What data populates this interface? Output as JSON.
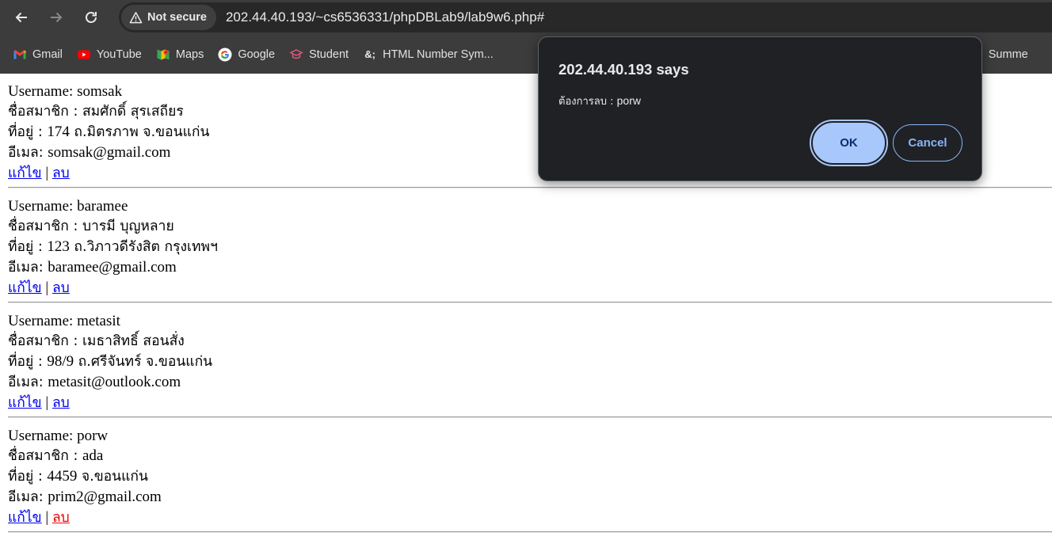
{
  "browser": {
    "security_label": "Not secure",
    "url": "202.44.40.193/~cs6536331/phpDBLab9/lab9w6.php#"
  },
  "bookmarks": [
    {
      "label": "Gmail",
      "icon": "gmail-icon"
    },
    {
      "label": "YouTube",
      "icon": "youtube-icon"
    },
    {
      "label": "Maps",
      "icon": "maps-icon"
    },
    {
      "label": "Google",
      "icon": "google-icon"
    },
    {
      "label": "Student",
      "icon": "student-icon"
    },
    {
      "label": "HTML Number Sym...",
      "icon": "ampersand-icon"
    },
    {
      "label": "Summe",
      "icon": "summer-icon"
    }
  ],
  "labels": {
    "username": "Username: ",
    "name": "ชื่อสมาชิก : ",
    "address": "ที่อยู่ : ",
    "email": "อีเมล: ",
    "edit": "แก้ไข",
    "separator": " | ",
    "delete": "ลบ"
  },
  "records": [
    {
      "username": "somsak",
      "name": "สมศักดิ์ สุรเสถียร",
      "address_num": "174",
      "address_text": " ถ.มิตรภาพ จ.ขอนแก่น",
      "email": "somsak@gmail.com"
    },
    {
      "username": "baramee",
      "name": "บารมี บุญหลาย",
      "address_num": "123",
      "address_text": " ถ.วิภาวดีรังสิต กรุงเทพฯ",
      "email": "baramee@gmail.com"
    },
    {
      "username": "metasit",
      "name": "เมธาสิทธิ์ สอนสั่ง",
      "address_num": "98/9",
      "address_text": " ถ.ศรีจันทร์ จ.ขอนแก่น",
      "email": "metasit@outlook.com"
    },
    {
      "username": "porw",
      "name": "ada",
      "address_num": "4459",
      "address_text": " จ.ขอนแก่น",
      "email": "prim2@gmail.com"
    }
  ],
  "dialog": {
    "title": "202.44.40.193 says",
    "message_prefix": "ต้องการลบ : ",
    "message_value": "porw",
    "ok_label": "OK",
    "cancel_label": "Cancel"
  },
  "colors": {
    "chrome": "#3c3c3c",
    "link": "#0000ee",
    "link_active": "#ee0000",
    "ok_button": "#a8c7fa"
  }
}
